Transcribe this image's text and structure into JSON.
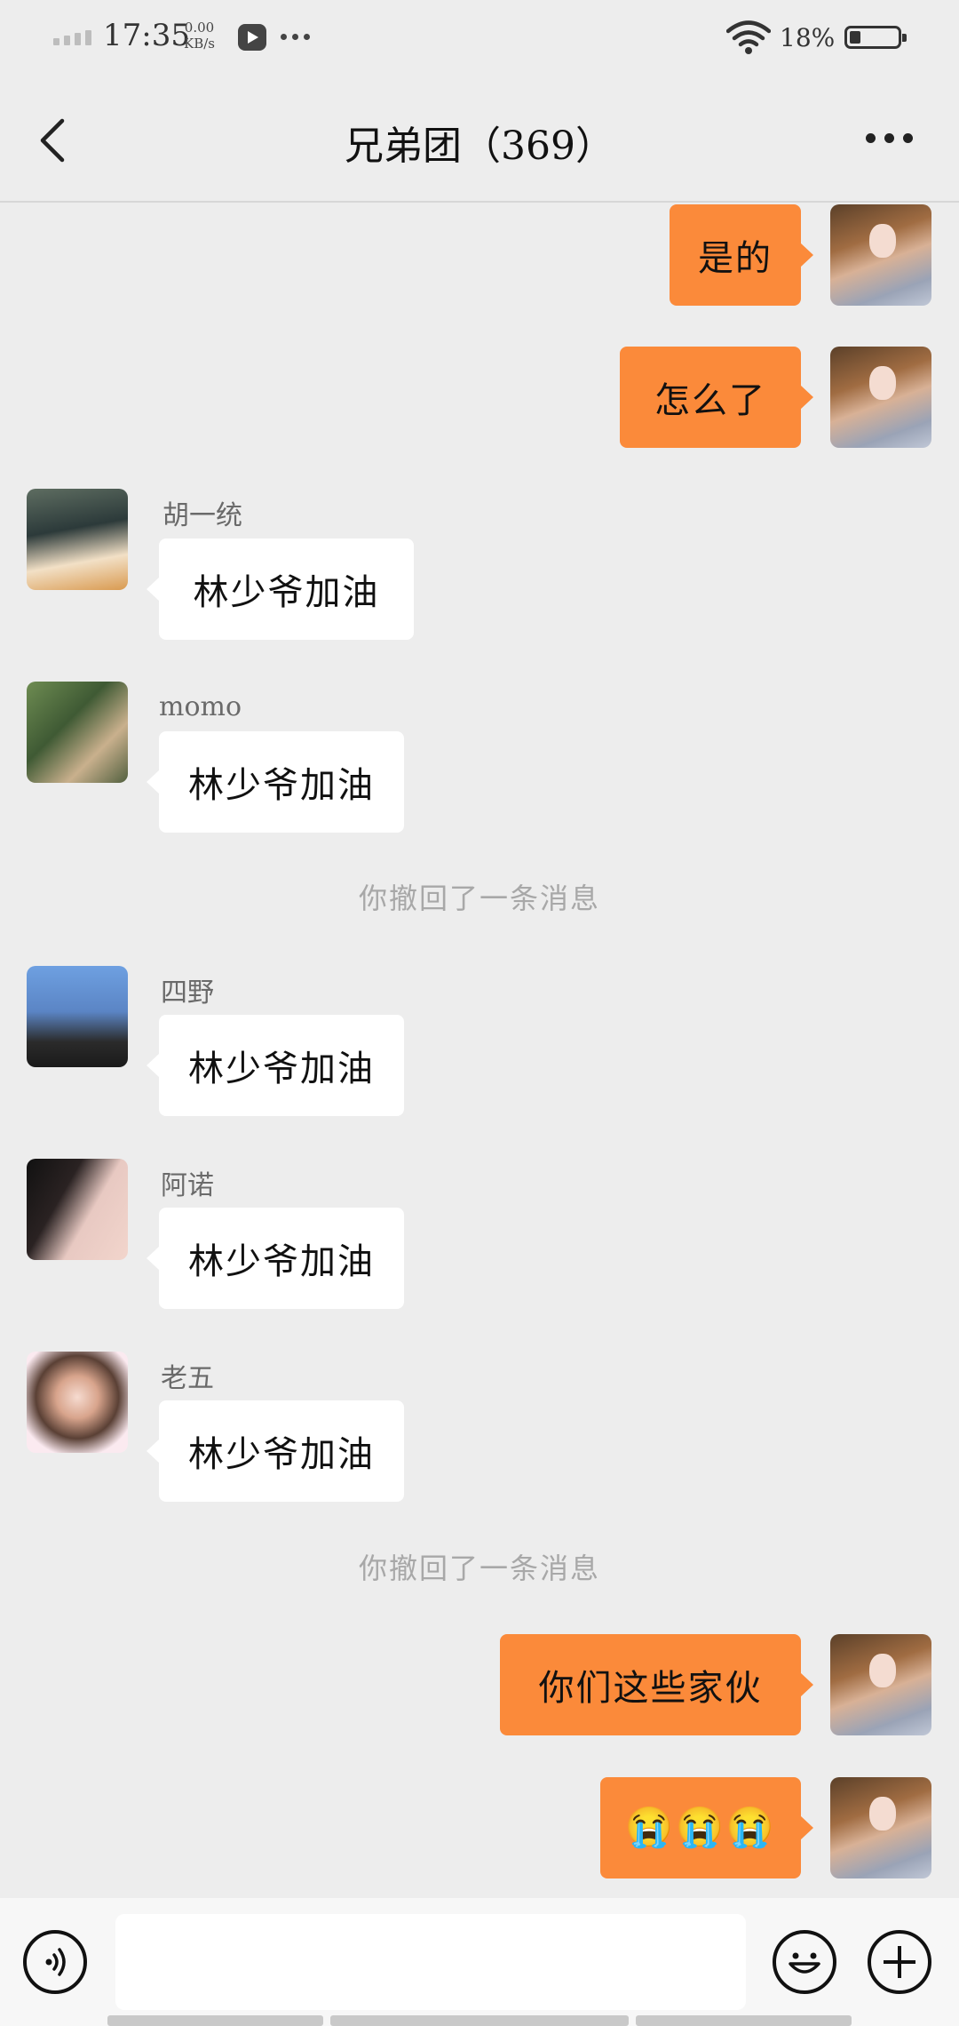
{
  "status_bar": {
    "time": "17:35",
    "speed_value": "0.00",
    "speed_unit": "KB/s",
    "battery": "18%"
  },
  "header": {
    "title": "兄弟团（369）",
    "back_icon": "chevron-left-icon",
    "more_icon": "more-dots-icon"
  },
  "messages": [
    {
      "side": "self",
      "text": "是的"
    },
    {
      "side": "self",
      "text": "怎么了"
    },
    {
      "side": "other",
      "sender": "胡一统",
      "text": "林少爷加油"
    },
    {
      "side": "other",
      "sender": "momo",
      "text": "林少爷加油"
    },
    {
      "side": "system",
      "text": "你撤回了一条消息"
    },
    {
      "side": "other",
      "sender": "四野",
      "text": "林少爷加油"
    },
    {
      "side": "other",
      "sender": "阿诺",
      "text": "林少爷加油"
    },
    {
      "side": "other",
      "sender": "老五",
      "text": "林少爷加油"
    },
    {
      "side": "system",
      "text": "你撤回了一条消息"
    },
    {
      "side": "self",
      "text": "你们这些家伙"
    },
    {
      "side": "self",
      "text": "😭😭😭"
    }
  ],
  "input_bar": {
    "voice_icon": "voice-icon",
    "emoji_icon": "smiley-icon",
    "plus_icon": "plus-icon"
  }
}
